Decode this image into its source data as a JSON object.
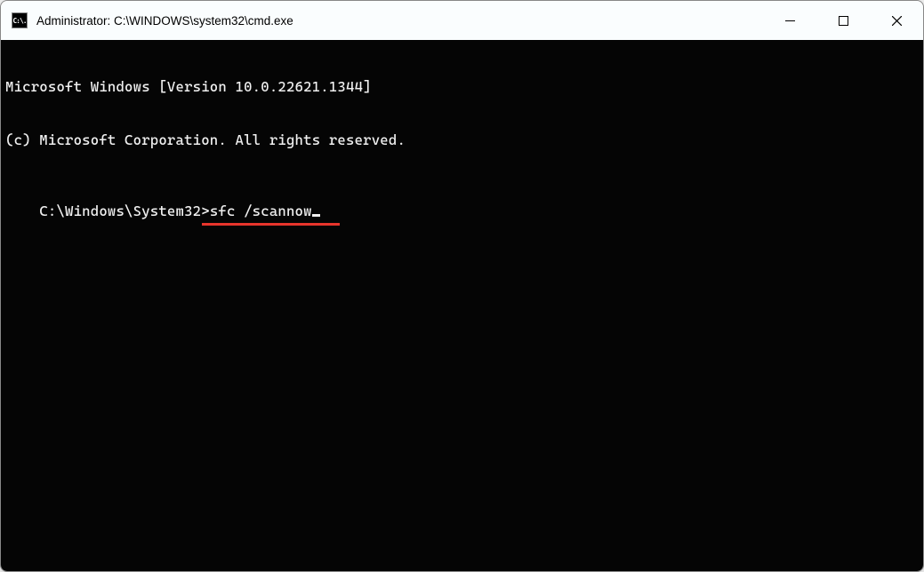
{
  "window": {
    "title": "Administrator: C:\\WINDOWS\\system32\\cmd.exe",
    "icon_text": "C:\\."
  },
  "terminal": {
    "line1": "Microsoft Windows [Version 10.0.22621.1344]",
    "line2": "(c) Microsoft Corporation. All rights reserved.",
    "blank": "",
    "prompt": "C:\\Windows\\System32>",
    "command": "sfc /scannow"
  }
}
